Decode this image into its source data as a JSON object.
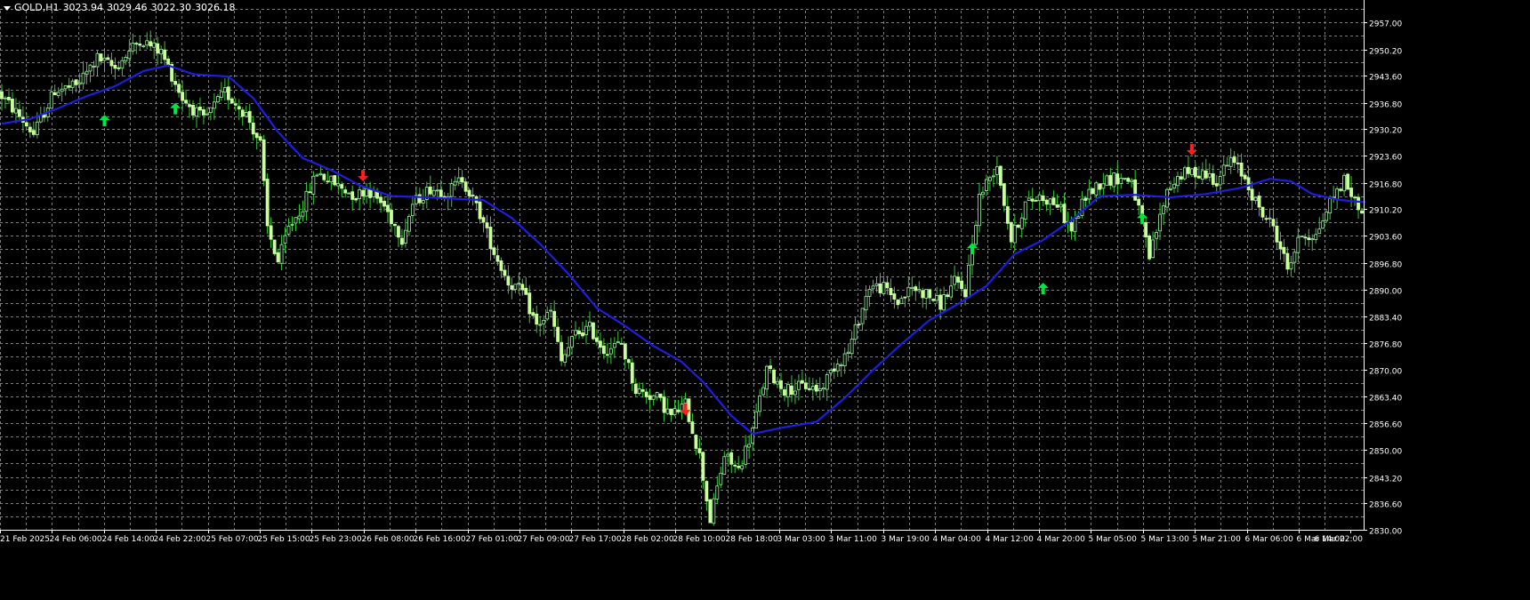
{
  "header": {
    "symbol": "GOLD,H1",
    "open": "3023.94",
    "high": "3029.46",
    "low": "3022.30",
    "close": "3026.18"
  },
  "colors": {
    "background": "#000000",
    "grid": "#7c7c7c",
    "axis": "#ffffff",
    "text": "#ffffff",
    "bull_fill": "#000000",
    "bull_border": "#98f5a0",
    "bear_fill": "#c9ff99",
    "wick": "#33cc33",
    "ma_line": "#1e1edc",
    "buy_arrow": "#00e641",
    "sell_arrow": "#ff1e1e"
  },
  "chart_data": {
    "type": "candlestick",
    "y_range": [
      2830.0,
      2957.0
    ],
    "y_ticks": [
      "2957.00",
      "2950.20",
      "2943.60",
      "2936.80",
      "2930.20",
      "2923.60",
      "2916.80",
      "2910.20",
      "2903.60",
      "2896.80",
      "2890.00",
      "2883.40",
      "2876.80",
      "2870.00",
      "2863.40",
      "2856.60",
      "2850.00",
      "2843.20",
      "2836.60",
      "2830.00"
    ],
    "x_labels": [
      "21 Feb 2025",
      "24 Feb 06:00",
      "24 Feb 14:00",
      "24 Feb 22:00",
      "25 Feb 07:00",
      "25 Feb 15:00",
      "25 Feb 23:00",
      "26 Feb 08:00",
      "26 Feb 16:00",
      "27 Feb 01:00",
      "27 Feb 09:00",
      "27 Feb 17:00",
      "28 Feb 02:00",
      "28 Feb 10:00",
      "28 Feb 18:00",
      "3 Mar 03:00",
      "3 Mar 11:00",
      "3 Mar 19:00",
      "4 Mar 04:00",
      "4 Mar 12:00",
      "4 Mar 20:00",
      "5 Mar 05:00",
      "5 Mar 13:00",
      "5 Mar 21:00",
      "6 Mar 06:00",
      "6 Mar 14:00",
      "6 Mar 22:00"
    ],
    "ma_anchors": [
      [
        0,
        2931.6
      ],
      [
        8,
        2932.8
      ],
      [
        16,
        2935.5
      ],
      [
        24,
        2938.5
      ],
      [
        32,
        2941.0
      ],
      [
        40,
        2944.8
      ],
      [
        47,
        2946.2
      ],
      [
        54,
        2944.0
      ],
      [
        64,
        2943.4
      ],
      [
        71,
        2938.0
      ],
      [
        78,
        2929.5
      ],
      [
        85,
        2923.0
      ],
      [
        93,
        2920.0
      ],
      [
        101,
        2916.2
      ],
      [
        110,
        2913.5
      ],
      [
        120,
        2913.2
      ],
      [
        128,
        2912.8
      ],
      [
        136,
        2912.5
      ],
      [
        144,
        2908.0
      ],
      [
        152,
        2901.5
      ],
      [
        160,
        2894.0
      ],
      [
        168,
        2885.5
      ],
      [
        176,
        2881.0
      ],
      [
        184,
        2876.0
      ],
      [
        192,
        2872.0
      ],
      [
        198,
        2867.0
      ],
      [
        206,
        2858.5
      ],
      [
        212,
        2854.0
      ],
      [
        220,
        2855.5
      ],
      [
        230,
        2857.0
      ],
      [
        238,
        2863.0
      ],
      [
        246,
        2870.0
      ],
      [
        254,
        2876.5
      ],
      [
        262,
        2882.5
      ],
      [
        270,
        2886.5
      ],
      [
        278,
        2891.0
      ],
      [
        286,
        2899.0
      ],
      [
        294,
        2902.5
      ],
      [
        302,
        2907.5
      ],
      [
        310,
        2913.5
      ],
      [
        320,
        2913.8
      ],
      [
        330,
        2913.2
      ],
      [
        340,
        2914.0
      ],
      [
        350,
        2915.6
      ],
      [
        358,
        2917.8
      ],
      [
        364,
        2917.2
      ],
      [
        370,
        2914.0
      ],
      [
        378,
        2912.5
      ],
      [
        384,
        2912.0
      ]
    ],
    "price_anchors": [
      [
        0,
        2939.5
      ],
      [
        6,
        2933.5
      ],
      [
        10,
        2929.0
      ],
      [
        16,
        2940.0
      ],
      [
        22,
        2941.0
      ],
      [
        28,
        2948.0
      ],
      [
        33,
        2945.5
      ],
      [
        40,
        2952.8
      ],
      [
        46,
        2949.5
      ],
      [
        52,
        2938.0
      ],
      [
        58,
        2932.5
      ],
      [
        64,
        2939.5
      ],
      [
        70,
        2934.0
      ],
      [
        74,
        2926.5
      ],
      [
        76,
        2905.5
      ],
      [
        79,
        2897.0
      ],
      [
        82,
        2905.5
      ],
      [
        86,
        2911.0
      ],
      [
        90,
        2919.5
      ],
      [
        96,
        2916.0
      ],
      [
        101,
        2913.5
      ],
      [
        104,
        2915.5
      ],
      [
        109,
        2911.0
      ],
      [
        114,
        2903.0
      ],
      [
        117,
        2911.5
      ],
      [
        122,
        2915.5
      ],
      [
        127,
        2914.5
      ],
      [
        131,
        2918.0
      ],
      [
        136,
        2909.0
      ],
      [
        140,
        2899.5
      ],
      [
        144,
        2892.0
      ],
      [
        148,
        2889.5
      ],
      [
        152,
        2881.0
      ],
      [
        156,
        2884.5
      ],
      [
        159,
        2872.0
      ],
      [
        163,
        2879.0
      ],
      [
        167,
        2880.5
      ],
      [
        171,
        2875.0
      ],
      [
        176,
        2876.5
      ],
      [
        180,
        2865.0
      ],
      [
        186,
        2863.0
      ],
      [
        190,
        2858.5
      ],
      [
        194,
        2861.5
      ],
      [
        198,
        2848.5
      ],
      [
        201,
        2832.5
      ],
      [
        205,
        2848.5
      ],
      [
        209,
        2845.0
      ],
      [
        213,
        2855.0
      ],
      [
        217,
        2870.0
      ],
      [
        222,
        2865.0
      ],
      [
        228,
        2866.0
      ],
      [
        232,
        2865.0
      ],
      [
        236,
        2871.0
      ],
      [
        240,
        2874.5
      ],
      [
        246,
        2891.0
      ],
      [
        250,
        2890.5
      ],
      [
        254,
        2887.0
      ],
      [
        258,
        2890.5
      ],
      [
        262,
        2889.0
      ],
      [
        266,
        2886.5
      ],
      [
        270,
        2892.0
      ],
      [
        273,
        2889.5
      ],
      [
        277,
        2913.5
      ],
      [
        282,
        2921.5
      ],
      [
        286,
        2902.5
      ],
      [
        290,
        2911.5
      ],
      [
        294,
        2913.5
      ],
      [
        299,
        2911.5
      ],
      [
        303,
        2905.0
      ],
      [
        307,
        2913.5
      ],
      [
        312,
        2917.5
      ],
      [
        316,
        2918.0
      ],
      [
        320,
        2917.5
      ],
      [
        325,
        2898.0
      ],
      [
        330,
        2915.0
      ],
      [
        334,
        2919.0
      ],
      [
        340,
        2919.5
      ],
      [
        344,
        2917.5
      ],
      [
        348,
        2922.5
      ],
      [
        352,
        2918.0
      ],
      [
        356,
        2910.0
      ],
      [
        360,
        2906.0
      ],
      [
        364,
        2895.5
      ],
      [
        368,
        2904.0
      ],
      [
        372,
        2903.5
      ],
      [
        376,
        2912.0
      ],
      [
        380,
        2917.5
      ],
      [
        384,
        2910.5
      ]
    ],
    "arrows": [
      {
        "kind": "buy",
        "bar": 29,
        "price": 2932.5
      },
      {
        "kind": "buy",
        "bar": 49,
        "price": 2935.5
      },
      {
        "kind": "sell",
        "bar": 102,
        "price": 2918.5
      },
      {
        "kind": "sell",
        "bar": 193,
        "price": 2860.0
      },
      {
        "kind": "buy",
        "bar": 274,
        "price": 2900.5
      },
      {
        "kind": "buy",
        "bar": 294,
        "price": 2890.5
      },
      {
        "kind": "buy",
        "bar": 322,
        "price": 2908.0
      },
      {
        "kind": "sell",
        "bar": 336,
        "price": 2925.0
      }
    ]
  }
}
